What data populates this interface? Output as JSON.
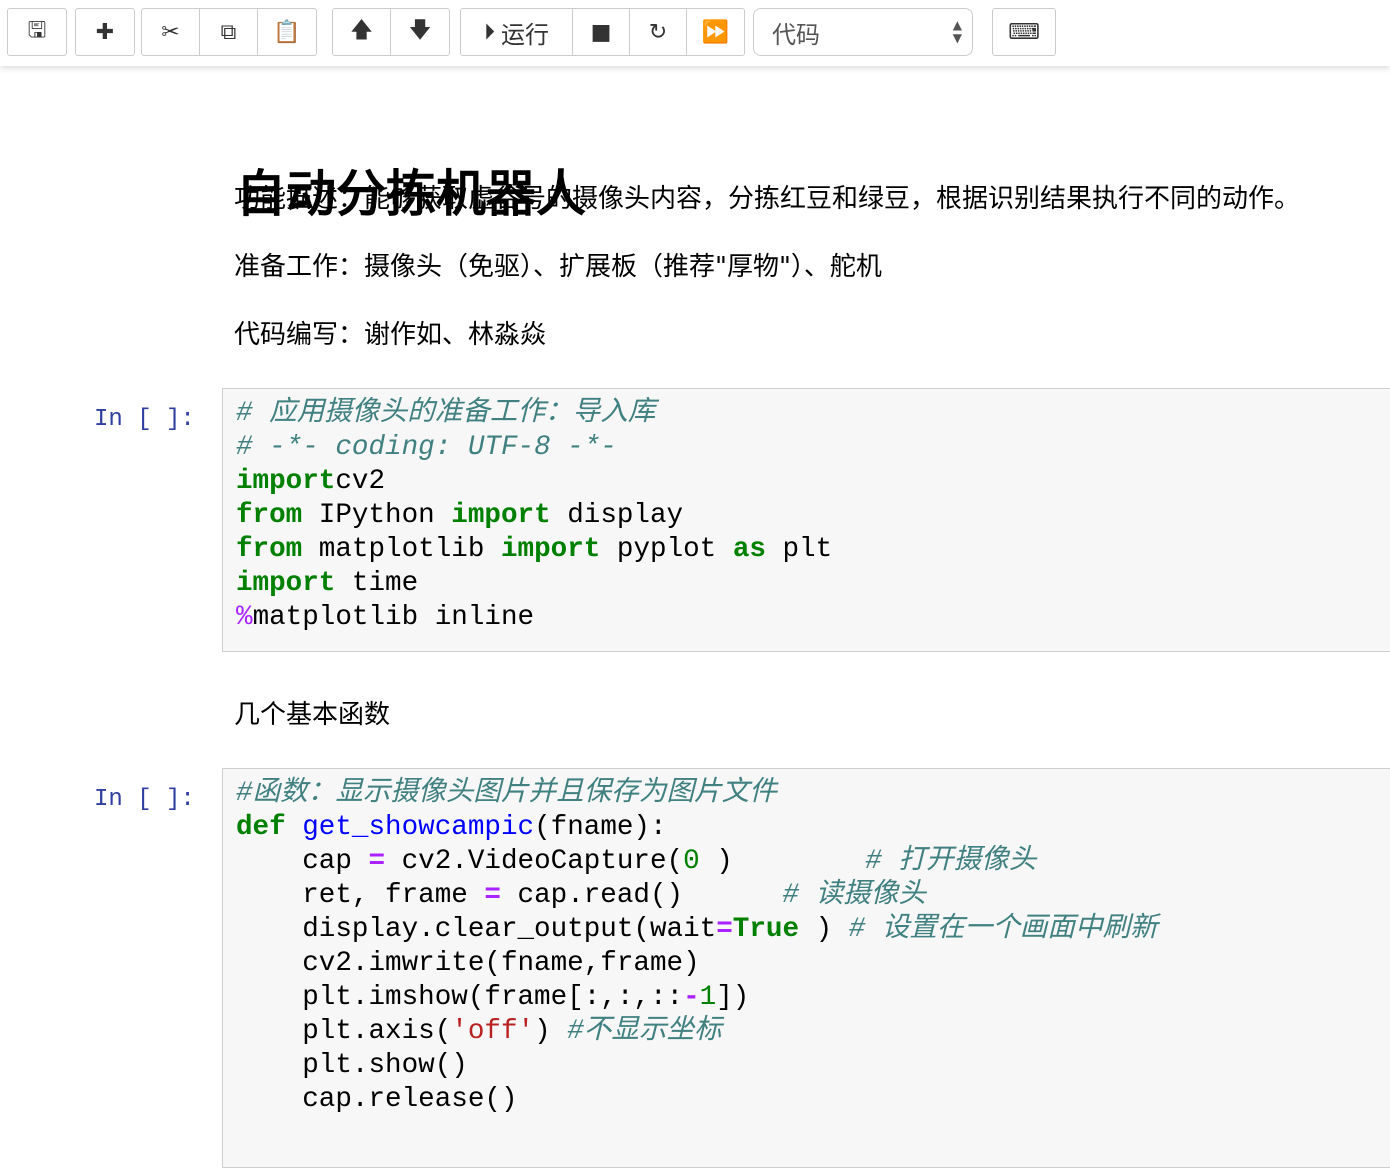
{
  "toolbar": {
    "groups": [
      [
        {
          "name": "save-button",
          "icon": "floppy-icon",
          "glyph": "🖫"
        }
      ],
      [
        {
          "name": "insert-cell-button",
          "icon": "plus-icon",
          "glyph": "✚"
        }
      ],
      [
        {
          "name": "cut-button",
          "icon": "scissors-icon",
          "glyph": "✂"
        },
        {
          "name": "copy-button",
          "icon": "copy-icon",
          "glyph": "⧉"
        },
        {
          "name": "paste-button",
          "icon": "paste-icon",
          "glyph": "📋"
        }
      ],
      [
        {
          "name": "move-up-button",
          "icon": "arrow-up-icon",
          "glyph": "🡅"
        },
        {
          "name": "move-down-button",
          "icon": "arrow-down-icon",
          "glyph": "🡇"
        }
      ],
      [
        {
          "name": "run-button",
          "icon": "step-forward-icon",
          "glyph": "⏵",
          "label": "运行"
        },
        {
          "name": "stop-button",
          "icon": "stop-icon",
          "glyph": "■"
        },
        {
          "name": "restart-button",
          "icon": "refresh-icon",
          "glyph": "↻"
        },
        {
          "name": "run-all-button",
          "icon": "fast-forward-icon",
          "glyph": "⏩"
        }
      ]
    ],
    "cell_type": "代码",
    "keyboard_icon": "keyboard-icon"
  },
  "notebook": {
    "title": "自动分拣机器人",
    "desc1": "功能描述：能够获取虚谷号的摄像头内容，分拣红豆和绿豆，根据识别结果执行不同的动作。",
    "desc2": "准备工作：摄像头（免驱）、扩展板（推荐\"厚物\"）、舵机",
    "desc3": "代码编写：谢作如、林淼焱",
    "prompt1": "In [ ]:",
    "md2": "几个基本函数",
    "prompt2": "In [ ]:",
    "cell1": [
      [
        [
          "c",
          "# 应用摄像头的准备工作：导入库"
        ]
      ],
      [
        [
          "c",
          "# -*- coding: UTF-8 -*-"
        ]
      ],
      [
        [
          "k",
          "import"
        ],
        [
          "",
          "cv2"
        ]
      ],
      [
        [
          "k",
          "from"
        ],
        [
          "",
          " IPython "
        ],
        [
          "k",
          "import"
        ],
        [
          "",
          " display"
        ]
      ],
      [
        [
          "k",
          "from"
        ],
        [
          "",
          " matplotlib "
        ],
        [
          "k",
          "import"
        ],
        [
          "",
          " pyplot "
        ],
        [
          "k",
          "as"
        ],
        [
          "",
          " plt"
        ]
      ],
      [
        [
          "k",
          "import"
        ],
        [
          "",
          " time"
        ]
      ],
      [
        [
          "m",
          "%"
        ],
        [
          "",
          "matplotlib inline"
        ]
      ]
    ],
    "cell2": [
      [
        [
          "c",
          "#函数：显示摄像头图片并且保存为图片文件"
        ]
      ],
      [
        [
          "k",
          "def"
        ],
        [
          "",
          " "
        ],
        [
          "f",
          "get_showcampic"
        ],
        [
          "",
          "(fname):"
        ]
      ],
      [
        [
          "",
          "    cap "
        ],
        [
          "o",
          "="
        ],
        [
          "",
          " cv2.VideoCapture("
        ],
        [
          "n",
          "0"
        ],
        [
          "",
          " )        "
        ],
        [
          "c",
          "# 打开摄像头"
        ]
      ],
      [
        [
          "",
          "    ret, frame "
        ],
        [
          "o",
          "="
        ],
        [
          "",
          " cap.read()      "
        ],
        [
          "c",
          "# 读摄像头"
        ]
      ],
      [
        [
          "",
          "    display.clear_output(wait"
        ],
        [
          "o",
          "="
        ],
        [
          "k",
          "True"
        ],
        [
          "",
          " ) "
        ],
        [
          "c",
          "# 设置在一个画面中刷新"
        ]
      ],
      [
        [
          "",
          "    cv2.imwrite(fname,frame)"
        ]
      ],
      [
        [
          "",
          "    plt.imshow(frame[:,:,::"
        ],
        [
          "o",
          "-"
        ],
        [
          "n",
          "1"
        ],
        [
          "",
          "])"
        ]
      ],
      [
        [
          "",
          "    plt.axis("
        ],
        [
          "s",
          "'off'"
        ],
        [
          "",
          ") "
        ],
        [
          "c",
          "#不显示坐标"
        ]
      ],
      [
        [
          "",
          "    plt.show()"
        ]
      ],
      [
        [
          "",
          "    cap.release()"
        ]
      ]
    ]
  }
}
